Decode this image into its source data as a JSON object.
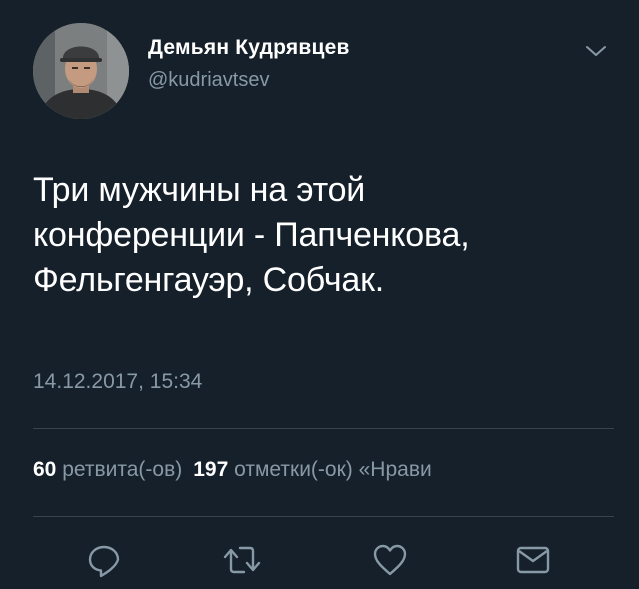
{
  "tweet": {
    "author": {
      "display_name": "Демьян Кудрявцев",
      "handle": "@kudriavtsev"
    },
    "text_lines": [
      "Три мужчины на этой",
      "конференции - Папченкова,",
      "Фельгенгауэр, Собчак."
    ],
    "timestamp": "14.12.2017, 15:34",
    "stats": {
      "retweets_count": "60",
      "retweets_label": "ретвита(-ов)",
      "likes_count": "197",
      "likes_label": "отметки(-ок)",
      "likes_more": "«Нрави"
    },
    "icons": {
      "caret": "chevron-down-icon",
      "reply": "reply-icon",
      "retweet": "retweet-icon",
      "like": "heart-icon",
      "message": "mail-icon"
    }
  },
  "colors": {
    "background": "#15202b",
    "primary_text": "#ffffff",
    "secondary_text": "#8899a6",
    "divider": "#38444d"
  }
}
